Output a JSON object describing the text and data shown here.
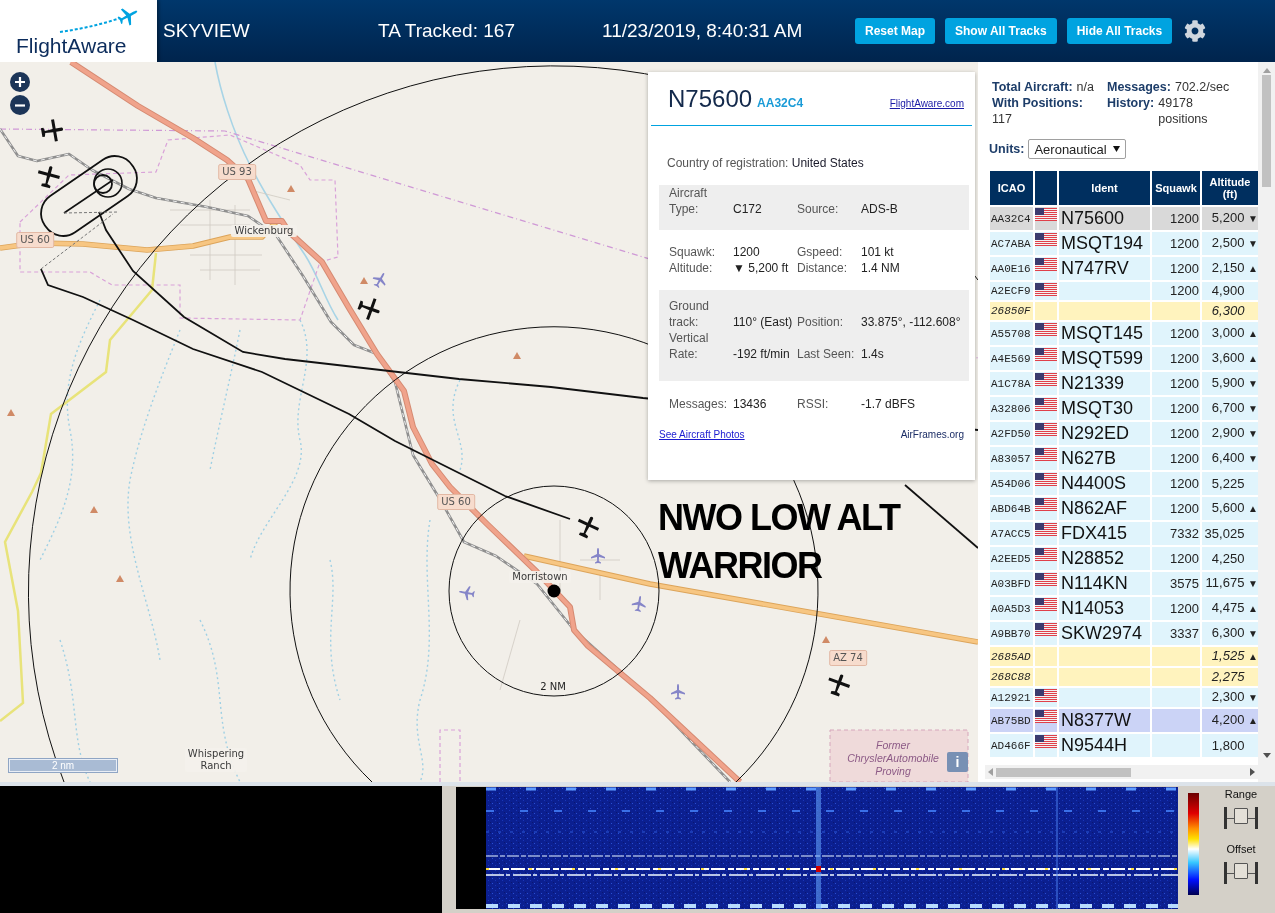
{
  "header": {
    "logo": "FlightAware",
    "title": "SKYVIEW",
    "tracked": "TA Tracked: 167",
    "datetime": "11/23/2019, 8:40:31 AM",
    "buttons": [
      "Reset Map",
      "Show All Tracks",
      "Hide All Tracks"
    ]
  },
  "map": {
    "shields": [
      "US 93",
      "US 60",
      "US 60",
      "AZ 74"
    ],
    "places": [
      "Wickenburg",
      "Morristown",
      "Whispering Ranch"
    ],
    "area_label": "Former ChryslerAutomobile Proving",
    "ring_label": "2 NM",
    "scale": "2 nm",
    "info_button": "i",
    "annotation": "NWO LOW ALT WARRIOR"
  },
  "popup": {
    "ident": "N75600",
    "icao": "AA32C4",
    "link": "FlightAware.com",
    "country_label": "Country of registration:",
    "country": "United States",
    "sections": [
      {
        "rows": [
          [
            {
              "label": "Aircraft Type:",
              "value": "C172"
            },
            {
              "label": "Source:",
              "value": "ADS-B"
            }
          ]
        ]
      },
      {
        "rows": [
          [
            {
              "label": "Squawk:",
              "value": "1200"
            },
            {
              "label": "Gspeed:",
              "value": "101 kt"
            }
          ],
          [
            {
              "label": "Altitude:",
              "value": "▼ 5,200 ft"
            },
            {
              "label": "Distance:",
              "value": "1.4 NM"
            }
          ]
        ]
      },
      {
        "rows": [
          [
            {
              "label": "Ground track:",
              "value": "110° (East)"
            },
            {
              "label": "Position:",
              "value": "33.875°, -112.608°"
            }
          ],
          [
            {
              "label": "Vertical Rate:",
              "value": "-192 ft/min"
            },
            {
              "label": "Last Seen:",
              "value": "1.4s"
            }
          ]
        ]
      },
      {
        "rows": [
          [
            {
              "label": "Messages:",
              "value": "13436"
            },
            {
              "label": "RSSI:",
              "value": "-1.7 dBFS"
            }
          ]
        ]
      }
    ],
    "photos_link": "See Aircraft Photos",
    "airframes_link": "AirFrames.org"
  },
  "sidebar": {
    "stats": [
      {
        "label": "Total Aircraft:",
        "value": "n/a"
      },
      {
        "label": "Messages:",
        "value": "702.2/sec"
      },
      {
        "label": "With Positions:",
        "value": "117"
      },
      {
        "label": "History:",
        "value": "49178 positions"
      }
    ],
    "units": {
      "label": "Units:",
      "value": "Aeronautical"
    },
    "table": {
      "columns": [
        "ICAO",
        "Ident",
        "Squawk",
        "Altitude (ft)"
      ],
      "rows": [
        {
          "icao": "AA32C4",
          "flag": true,
          "ident": "N75600",
          "squawk": "1200",
          "altitude": "5,200",
          "trend": "▼",
          "kind": "positioned",
          "selected": true,
          "hovered": false
        },
        {
          "icao": "AC7ABA",
          "flag": true,
          "ident": "MSQT194",
          "squawk": "1200",
          "altitude": "2,500",
          "trend": "▼",
          "kind": "positioned",
          "selected": false,
          "hovered": false
        },
        {
          "icao": "AA0E16",
          "flag": true,
          "ident": "N747RV",
          "squawk": "1200",
          "altitude": "2,150",
          "trend": "▲",
          "kind": "positioned",
          "selected": false,
          "hovered": false
        },
        {
          "icao": "A2ECF9",
          "flag": true,
          "squawk": "1200",
          "altitude": "4,900",
          "kind": "positioned",
          "selected": false,
          "hovered": false
        },
        {
          "icao": "26850F",
          "flag": false,
          "altitude": "6,300",
          "kind": "unpositioned",
          "selected": false,
          "hovered": false
        },
        {
          "icao": "A55708",
          "flag": true,
          "ident": "MSQT145",
          "squawk": "1200",
          "altitude": "3,000",
          "trend": "▲",
          "kind": "positioned",
          "selected": false,
          "hovered": false
        },
        {
          "icao": "A4E569",
          "flag": true,
          "ident": "MSQT599",
          "squawk": "1200",
          "altitude": "3,600",
          "trend": "▲",
          "kind": "positioned",
          "selected": false,
          "hovered": false
        },
        {
          "icao": "A1C78A",
          "flag": true,
          "ident": "N21339",
          "squawk": "1200",
          "altitude": "5,900",
          "trend": "▼",
          "kind": "positioned",
          "selected": false,
          "hovered": false
        },
        {
          "icao": "A32806",
          "flag": true,
          "ident": "MSQT30",
          "squawk": "1200",
          "altitude": "6,700",
          "trend": "▼",
          "kind": "positioned",
          "selected": false,
          "hovered": false
        },
        {
          "icao": "A2FD50",
          "flag": true,
          "ident": "N292ED",
          "squawk": "1200",
          "altitude": "2,900",
          "trend": "▼",
          "kind": "positioned",
          "selected": false,
          "hovered": false
        },
        {
          "icao": "A83057",
          "flag": true,
          "ident": "N627B",
          "squawk": "1200",
          "altitude": "6,400",
          "trend": "▼",
          "kind": "positioned",
          "selected": false,
          "hovered": false
        },
        {
          "icao": "A54D06",
          "flag": true,
          "ident": "N4400S",
          "squawk": "1200",
          "altitude": "5,225",
          "kind": "positioned",
          "selected": false,
          "hovered": false
        },
        {
          "icao": "ABD64B",
          "flag": true,
          "ident": "N862AF",
          "squawk": "1200",
          "altitude": "5,600",
          "trend": "▲",
          "kind": "positioned",
          "selected": false,
          "hovered": false
        },
        {
          "icao": "A7ACC5",
          "flag": true,
          "ident": "FDX415",
          "squawk": "7332",
          "altitude": "35,025",
          "kind": "positioned",
          "selected": false,
          "hovered": false
        },
        {
          "icao": "A2EED5",
          "flag": true,
          "ident": "N28852",
          "squawk": "1200",
          "altitude": "4,250",
          "kind": "positioned",
          "selected": false,
          "hovered": false
        },
        {
          "icao": "A03BFD",
          "flag": true,
          "ident": "N114KN",
          "squawk": "3575",
          "altitude": "11,675",
          "trend": "▼",
          "kind": "positioned",
          "selected": false,
          "hovered": false
        },
        {
          "icao": "A0A5D3",
          "flag": true,
          "ident": "N14053",
          "squawk": "1200",
          "altitude": "4,475",
          "trend": "▲",
          "kind": "positioned",
          "selected": false,
          "hovered": false
        },
        {
          "icao": "A9BB70",
          "flag": true,
          "ident": "SKW2974",
          "squawk": "3337",
          "altitude": "6,300",
          "trend": "▼",
          "kind": "positioned",
          "selected": false,
          "hovered": false
        },
        {
          "icao": "2685AD",
          "flag": false,
          "altitude": "1,525",
          "trend": "▲",
          "kind": "unpositioned",
          "selected": false,
          "hovered": false
        },
        {
          "icao": "268C88",
          "flag": false,
          "altitude": "2,275",
          "kind": "unpositioned",
          "selected": false,
          "hovered": false
        },
        {
          "icao": "A12921",
          "flag": true,
          "altitude": "2,300",
          "trend": "▼",
          "kind": "positioned",
          "selected": false,
          "hovered": false
        },
        {
          "icao": "AB75BD",
          "flag": true,
          "ident": "N8377W",
          "altitude": "4,200",
          "trend": "▲",
          "kind": "positioned",
          "selected": false,
          "hovered": true
        },
        {
          "icao": "AD466F",
          "flag": true,
          "ident": "N9544H",
          "altitude": "1,800",
          "kind": "positioned",
          "selected": false,
          "hovered": false
        }
      ]
    }
  },
  "spectrum": {
    "sliders": [
      {
        "label": "Range",
        "level": 0.5
      },
      {
        "label": "Offset",
        "level": 0.5
      }
    ]
  }
}
